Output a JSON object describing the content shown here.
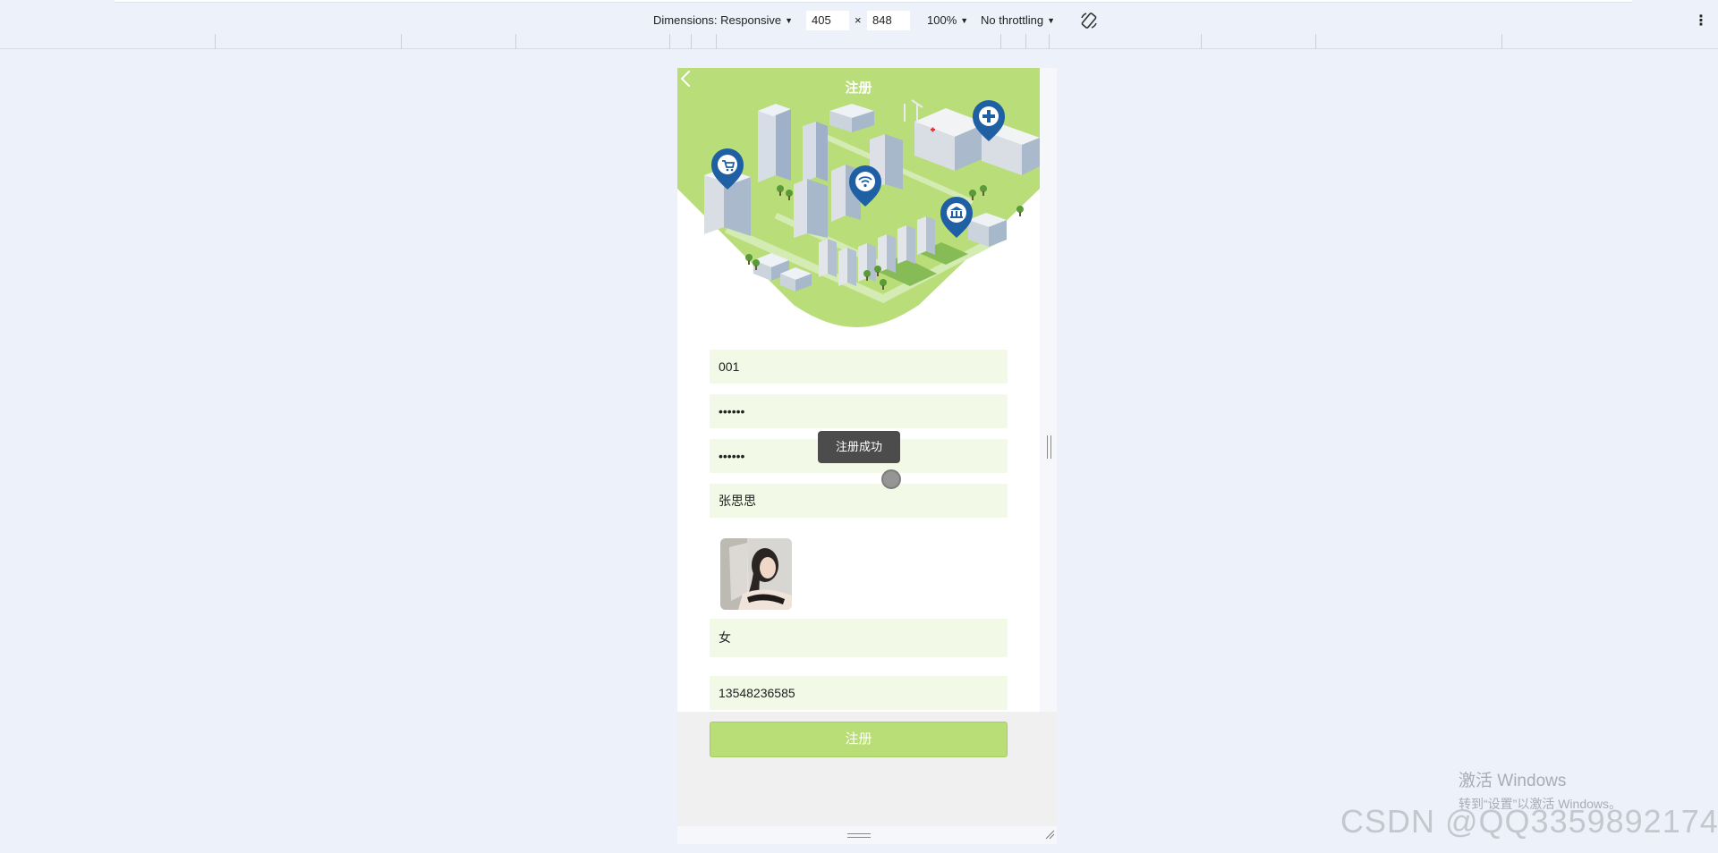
{
  "devtools": {
    "dimensions_label": "Dimensions: Responsive",
    "width": "405",
    "times": "×",
    "height": "848",
    "zoom": "100%",
    "throttling": "No throttling",
    "caret": "▼",
    "more": "⋮"
  },
  "page": {
    "title": "注册",
    "back_icon": "chevron-left-icon",
    "fields": {
      "username": "001",
      "password": "••••••",
      "confirm_password": "••••••",
      "name": "张思思",
      "gender": "女",
      "phone": "13548236585"
    },
    "submit_label": "注册",
    "toast": "注册成功"
  },
  "colors": {
    "accent_green": "#b9de78",
    "field_bg": "#f2f9e7",
    "pin_blue": "#1f5fa3"
  },
  "watermark": {
    "windows_line1": "激活 Windows",
    "windows_line2": "转到“设置”以激活 Windows。",
    "csdn": "CSDN @QQ3359892174"
  }
}
